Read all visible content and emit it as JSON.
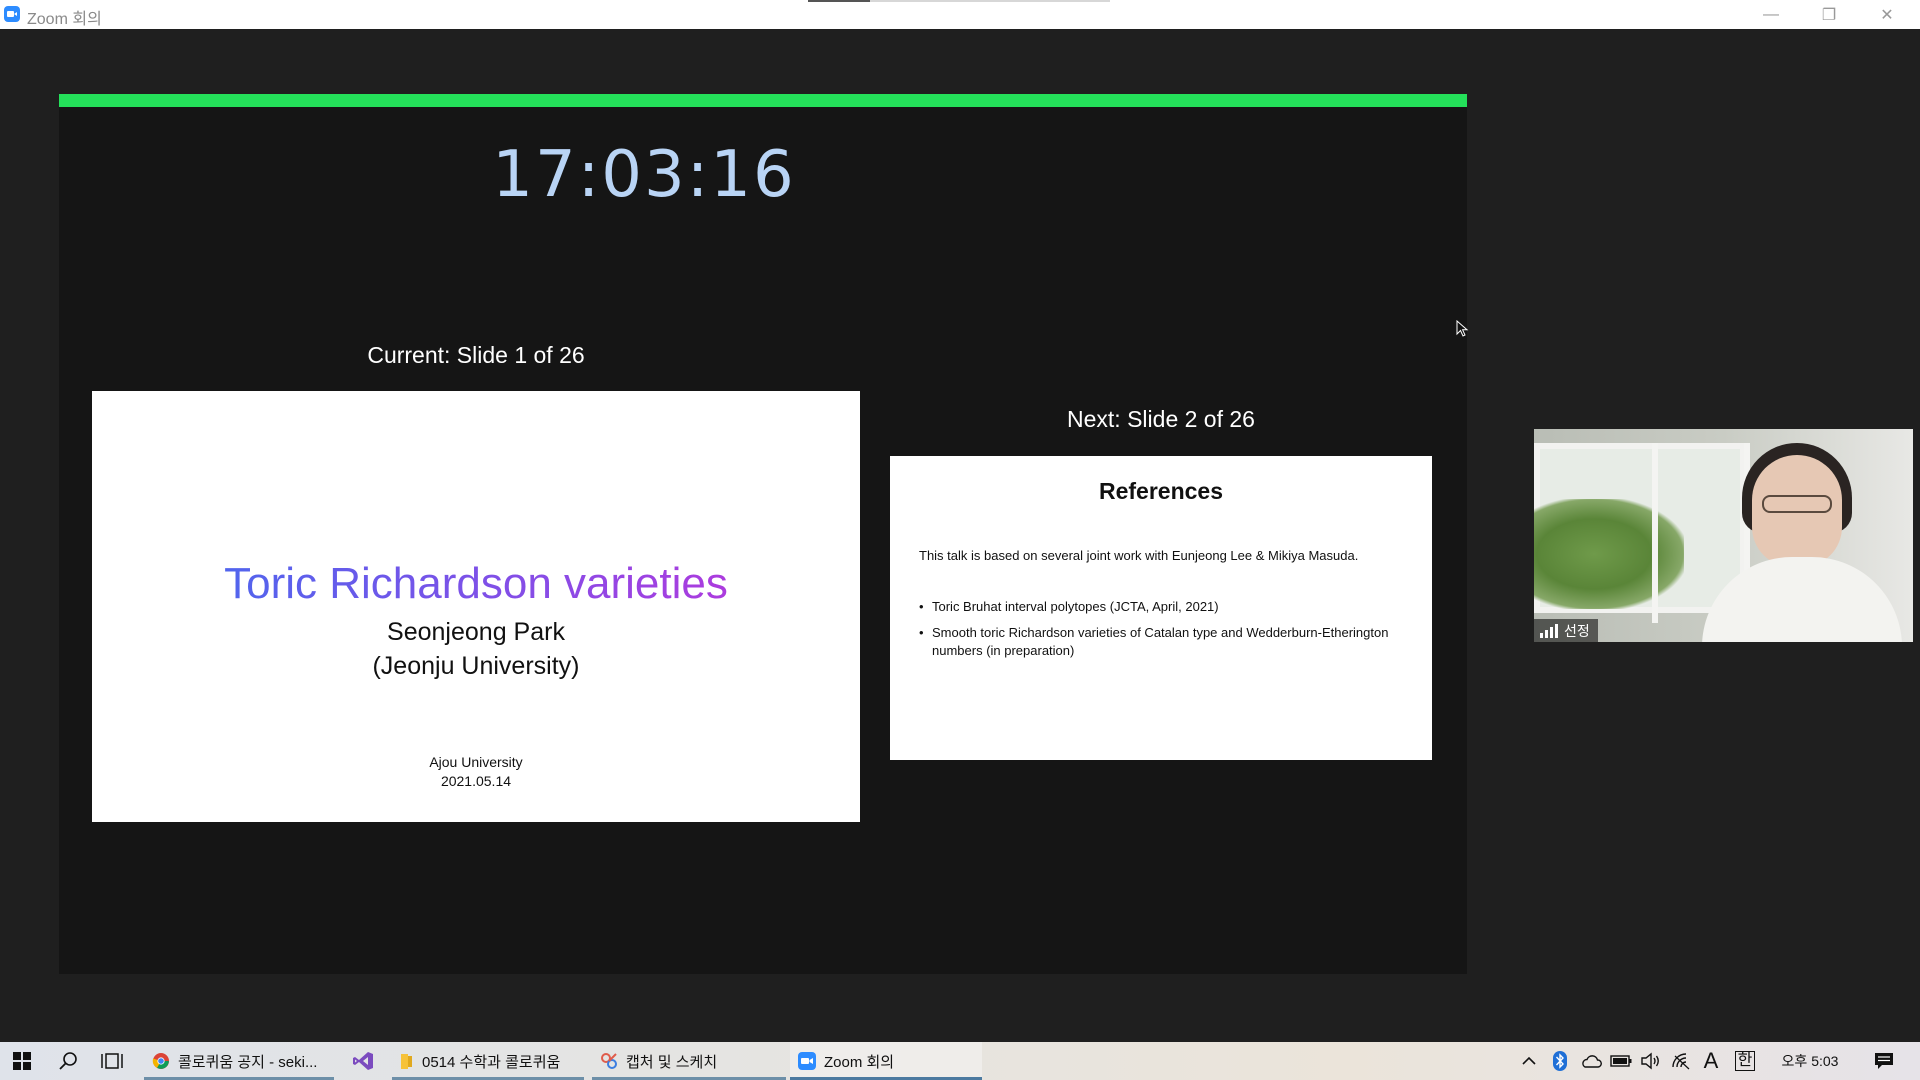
{
  "window": {
    "title": "Zoom 회의",
    "minimize_glyph": "—",
    "restore_glyph": "❐",
    "close_glyph": "✕"
  },
  "presenter": {
    "clock": "17:03:16",
    "progress_fraction": 1.0,
    "progress_color": "#24e05a",
    "current_label": "Current: Slide 1 of 26",
    "next_label": "Next: Slide 2 of 26"
  },
  "current_slide": {
    "title": "Toric Richardson varieties",
    "author": "Seonjeong Park",
    "affiliation": "(Jeonju University)",
    "venue": "Ajou University",
    "date": "2021.05.14"
  },
  "next_slide": {
    "title": "References",
    "intro": "This talk is based on several joint work with Eunjeong Lee & Mikiya Masuda.",
    "items": [
      "Toric Bruhat interval polytopes (JCTA, April, 2021)",
      "Smooth toric Richardson varieties of Catalan type and Wedderburn-Etherington numbers (in preparation)"
    ]
  },
  "video": {
    "participant_name": "선정"
  },
  "taskbar": {
    "apps": [
      {
        "label": "콜로퀴움 공지 - seki...",
        "icon": "chrome-icon"
      },
      {
        "label": "",
        "icon": "visual-studio-icon"
      },
      {
        "label": "0514 수학과 콜로퀴움",
        "icon": "folder-icon"
      },
      {
        "label": "캡처 및 스케치",
        "icon": "snip-sketch-icon"
      },
      {
        "label": "Zoom 회의",
        "icon": "zoom-icon"
      }
    ],
    "tray": {
      "ime_letter": "A",
      "ime_lang": "한",
      "clock": "오후 5:03"
    }
  }
}
